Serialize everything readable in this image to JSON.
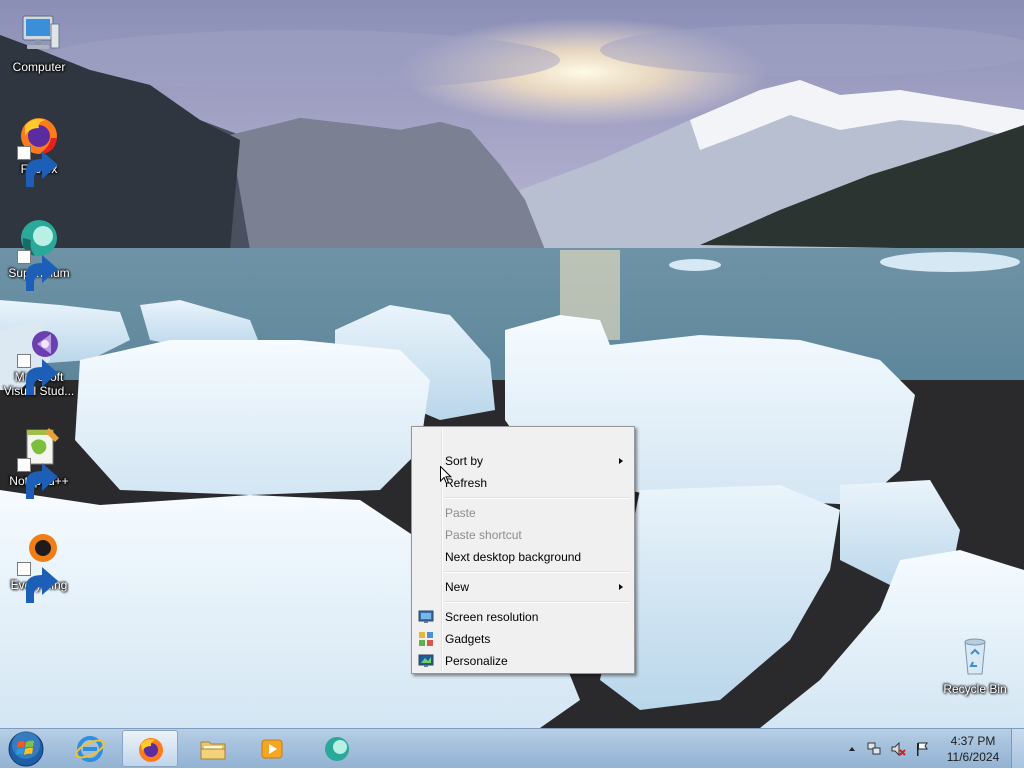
{
  "desktop": {
    "icons": [
      {
        "label": "Computer",
        "icon": "computer-icon"
      },
      {
        "label": "Firefox",
        "icon": "firefox-icon"
      },
      {
        "label": "Supermium",
        "icon": "supermium-icon"
      },
      {
        "label": "Microsoft Visual Stud...",
        "icon": "visual-studio-icon"
      },
      {
        "label": "Notepad++",
        "icon": "notepadpp-icon"
      },
      {
        "label": "Everything",
        "icon": "everything-icon"
      },
      {
        "label": "Recycle Bin",
        "icon": "recycle-bin-icon"
      }
    ]
  },
  "context_menu": {
    "items": [
      {
        "label": "Sort by",
        "submenu": true
      },
      {
        "label": "Refresh"
      },
      {
        "label": "Paste",
        "disabled": true
      },
      {
        "label": "Paste shortcut",
        "disabled": true
      },
      {
        "label": "Next desktop background"
      },
      {
        "label": "New",
        "submenu": true
      },
      {
        "label": "Screen resolution",
        "icon": "screen-resolution-icon"
      },
      {
        "label": "Gadgets",
        "icon": "gadgets-icon"
      },
      {
        "label": "Personalize",
        "icon": "personalize-icon"
      }
    ]
  },
  "taskbar": {
    "pinned": [
      {
        "name": "internet-explorer",
        "icon": "internet-explorer-icon"
      },
      {
        "name": "firefox",
        "icon": "firefox-icon",
        "active": true
      },
      {
        "name": "file-explorer",
        "icon": "folder-icon"
      },
      {
        "name": "media-player",
        "icon": "media-player-icon"
      },
      {
        "name": "supermium",
        "icon": "supermium-icon"
      }
    ],
    "clock": {
      "time": "4:37 PM",
      "date": "11/6/2024"
    }
  },
  "colors": {
    "taskbar": "#a4c0dc",
    "menu_background": "#f0f0f0",
    "disabled_text": "#8d8d8d"
  }
}
